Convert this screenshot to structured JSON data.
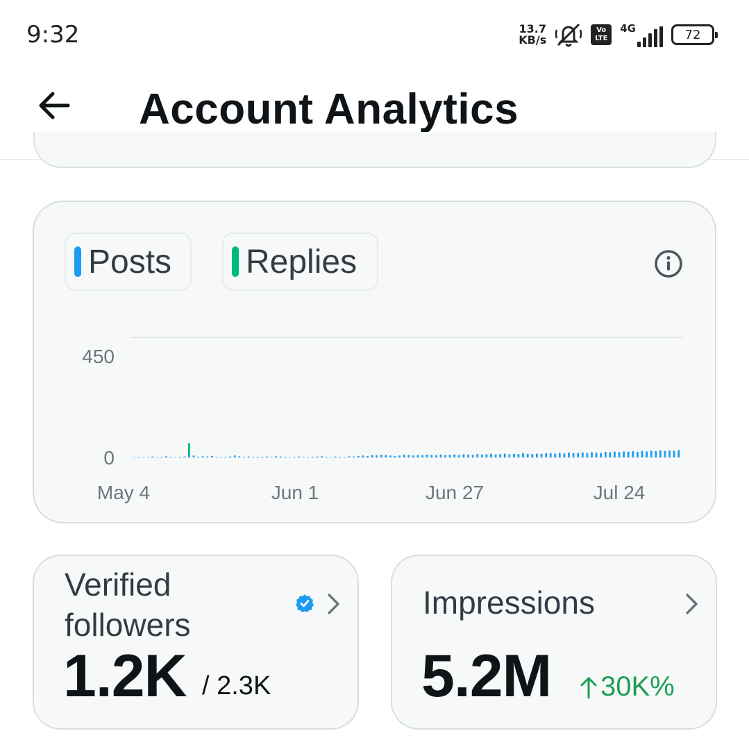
{
  "status_bar": {
    "time": "9:32",
    "net_speed_value": "13.7",
    "net_speed_unit": "KB/s",
    "mute_icon": "bell-off-icon",
    "volte_top": "Vo",
    "volte_bottom": "LTE",
    "network_type": "4G",
    "battery_level": "72"
  },
  "header": {
    "title": "Account Analytics",
    "back_icon": "arrow-left-icon"
  },
  "chart_card": {
    "legend": [
      {
        "label": "Posts",
        "color": "#1d9bf0"
      },
      {
        "label": "Replies",
        "color": "#00ba7c"
      }
    ],
    "info_icon": "info-icon"
  },
  "chart_data": {
    "type": "bar",
    "stacked": true,
    "y_ticks": [
      "450",
      "0"
    ],
    "ylim": [
      0,
      500
    ],
    "grid": "top gridline at 500",
    "x_tick_labels": [
      "May 4",
      "Jun 1",
      "Jun 27",
      "Jul 24"
    ],
    "series": [
      {
        "name": "Posts",
        "color": "#1d9bf0",
        "values": [
          2,
          3,
          2,
          2,
          4,
          2,
          3,
          5,
          3,
          2,
          3,
          4,
          12,
          8,
          3,
          5,
          4,
          6,
          3,
          2,
          3,
          4,
          8,
          5,
          3,
          4,
          2,
          3,
          3,
          4,
          3,
          5,
          4,
          3,
          2,
          3,
          4,
          3,
          2,
          3,
          4,
          5,
          3,
          2,
          4,
          3,
          3,
          5,
          4,
          6,
          8,
          6,
          10,
          9,
          11,
          10,
          8,
          6,
          8,
          12,
          10,
          8,
          10,
          9,
          12,
          11,
          9,
          12,
          10,
          11,
          12,
          10,
          13,
          12,
          11,
          14,
          12,
          13,
          15,
          12,
          14,
          16,
          13,
          15,
          14,
          18,
          15,
          14,
          16,
          15,
          17,
          18,
          16,
          19,
          17,
          20,
          18,
          19,
          21,
          18,
          22,
          20,
          19,
          23,
          21,
          24,
          22,
          25,
          24,
          26,
          23,
          27,
          25,
          28,
          26,
          30,
          27,
          29,
          28,
          31
        ]
      },
      {
        "name": "Replies",
        "color": "#00ba7c",
        "values": [
          0,
          0,
          0,
          0,
          0,
          0,
          0,
          0,
          0,
          0,
          0,
          0,
          48,
          0,
          0,
          0,
          0,
          0,
          0,
          0,
          0,
          0,
          0,
          0,
          0,
          0,
          0,
          0,
          0,
          0,
          0,
          0,
          0,
          0,
          0,
          0,
          0,
          0,
          0,
          0,
          0,
          0,
          0,
          0,
          0,
          0,
          0,
          0,
          0,
          0,
          0,
          0,
          0,
          0,
          0,
          0,
          0,
          0,
          0,
          0,
          0,
          0,
          0,
          0,
          0,
          0,
          0,
          0,
          0,
          0,
          0,
          0,
          0,
          0,
          0,
          0,
          0,
          0,
          0,
          0,
          0,
          0,
          0,
          0,
          0,
          0,
          0,
          0,
          0,
          0,
          0,
          0,
          0,
          0,
          0,
          0,
          0,
          0,
          0,
          0,
          0,
          0,
          0,
          0,
          0,
          0,
          0,
          0,
          0,
          0,
          0,
          0,
          0,
          0,
          0,
          0,
          0,
          0,
          0,
          0
        ]
      }
    ]
  },
  "followers_card": {
    "label": "Verified followers",
    "value": "1.2K",
    "total": "/ 2.3K",
    "verified_icon": "verified-badge-icon",
    "chevron_icon": "chevron-right-icon"
  },
  "impressions_card": {
    "label": "Impressions",
    "value": "5.2M",
    "change": "30K%",
    "change_icon": "arrow-up-icon",
    "change_color": "#1f9d55",
    "chevron_icon": "chevron-right-icon"
  }
}
